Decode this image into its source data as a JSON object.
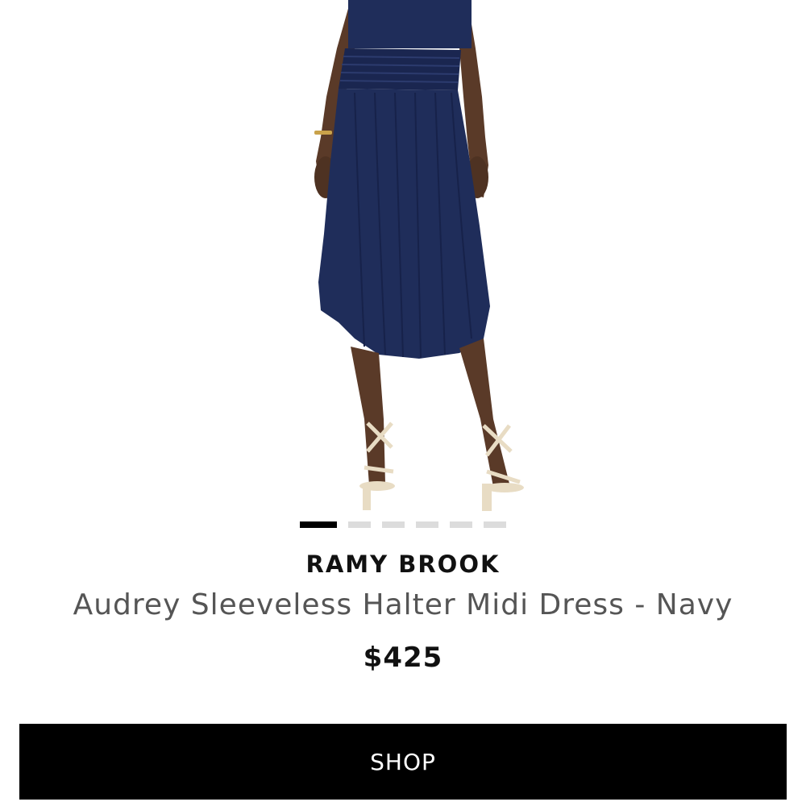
{
  "product": {
    "image_icon": "product-photo-navy-midi-dress",
    "brand": "RAMY BROOK",
    "name": "Audrey Sleeveless Halter Midi Dress - Navy",
    "price": "$425"
  },
  "carousel": {
    "total_slides": 6,
    "active_index": 0
  },
  "actions": {
    "shop_label": "SHOP"
  },
  "colors": {
    "dress": "#1f2d5a",
    "button_bg": "#000000",
    "button_text": "#ffffff",
    "dot_active": "#000000",
    "dot_inactive": "#dcdcdc"
  }
}
